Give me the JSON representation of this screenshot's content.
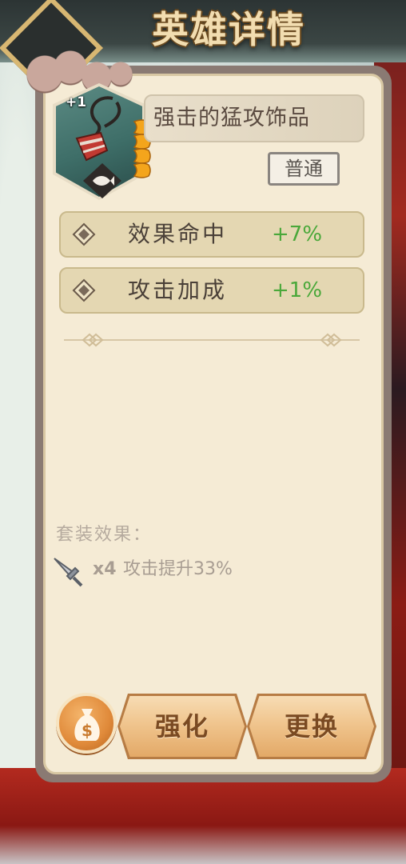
{
  "header": {
    "title": "英雄详情"
  },
  "equipment": {
    "level": "+1",
    "name": "强击的猛攻饰品",
    "rarity": "普通",
    "stars": 4
  },
  "stats": [
    {
      "label": "效果命中",
      "value": "+7%"
    },
    {
      "label": "攻击加成",
      "value": "+1%"
    }
  ],
  "set_bonus": {
    "title": "套装效果：",
    "count": "x4",
    "effect": "攻击提升33%",
    "icon": "sword-icon"
  },
  "buttons": {
    "money_icon": "money-bag-icon",
    "upgrade": "强化",
    "replace": "更换"
  },
  "colors": {
    "panel_bg": "#f5ebd5",
    "stat_value": "#4aa83a",
    "button_fill": "#f0c58e"
  }
}
